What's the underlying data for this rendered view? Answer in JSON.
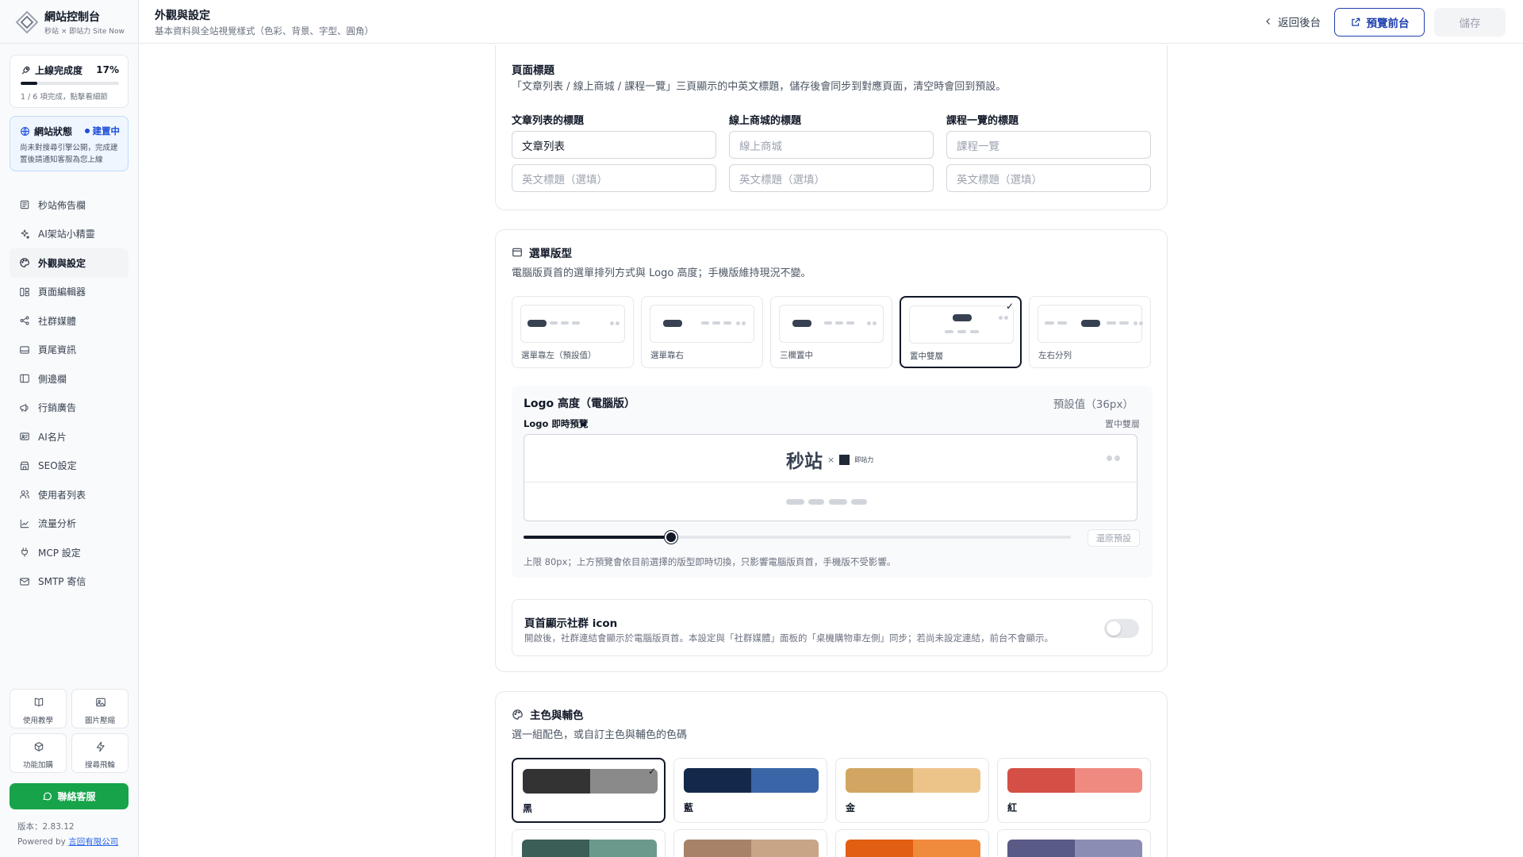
{
  "brand": {
    "title": "網站控制台",
    "subtitle": "秒站 × 即站力 Site Now"
  },
  "progress": {
    "label": "上線完成度",
    "percent_text": "17%",
    "fraction": 0.17,
    "detail": "1 / 6 項完成，點擊看細節"
  },
  "site_status": {
    "label": "網站狀態",
    "badge": "建置中",
    "description": "尚未對搜尋引擎公開，完成建置後請通知客服為您上線"
  },
  "nav": [
    {
      "label": "秒站佈告欄",
      "icon": "newspaper-icon"
    },
    {
      "label": "AI架站小精靈",
      "icon": "sparkles-icon"
    },
    {
      "label": "外觀與設定",
      "icon": "palette-icon",
      "active": true
    },
    {
      "label": "頁面編輯器",
      "icon": "layout-icon"
    },
    {
      "label": "社群媒體",
      "icon": "share-icon"
    },
    {
      "label": "頁尾資訊",
      "icon": "footer-icon"
    },
    {
      "label": "側邊欄",
      "icon": "sidebar-icon"
    },
    {
      "label": "行銷廣告",
      "icon": "megaphone-icon"
    },
    {
      "label": "AI名片",
      "icon": "id-card-icon"
    },
    {
      "label": "SEO設定",
      "icon": "store-icon"
    },
    {
      "label": "使用者列表",
      "icon": "users-icon"
    },
    {
      "label": "流量分析",
      "icon": "chart-icon"
    },
    {
      "label": "MCP 設定",
      "icon": "plug-icon"
    },
    {
      "label": "SMTP 寄信",
      "icon": "mail-icon"
    }
  ],
  "tools": [
    {
      "label": "使用教學",
      "icon": "book-icon"
    },
    {
      "label": "圖片壓縮",
      "icon": "image-icon"
    },
    {
      "label": "功能加購",
      "icon": "package-icon"
    },
    {
      "label": "搜尋飛輪",
      "icon": "zap-icon"
    }
  ],
  "contact_label": "聯絡客服",
  "version": "版本：2.83.12",
  "powered_prefix": "Powered by ",
  "powered_link": "言回有限公司",
  "header": {
    "title": "外觀與設定",
    "subtitle": "基本資料與全站視覺樣式（色彩、背景、字型、圓角）",
    "back_label": "返回後台",
    "preview_label": "預覽前台",
    "save_label": "儲存"
  },
  "page_titles": {
    "title": "頁面標題",
    "description": "「文章列表 / 線上商城 / 課程一覽」三頁顯示的中英文標題，儲存後會同步到對應頁面，清空時會回到預設。",
    "fields": [
      {
        "label": "文章列表的標題",
        "value": "文章列表",
        "placeholder": "文章列表",
        "en_placeholder": "英文標題（選填）",
        "filled": true
      },
      {
        "label": "線上商城的標題",
        "value": "",
        "placeholder": "線上商城",
        "en_placeholder": "英文標題（選填）",
        "filled": false
      },
      {
        "label": "課程一覽的標題",
        "value": "",
        "placeholder": "課程一覽",
        "en_placeholder": "英文標題（選填）",
        "filled": false
      }
    ]
  },
  "menu_layout": {
    "title": "選單版型",
    "description": "電腦版頁首的選單排列方式與 Logo 高度；手機版維持現況不變。",
    "options": [
      {
        "label": "選單靠左（預設值）",
        "selected": false
      },
      {
        "label": "選單靠右",
        "selected": false
      },
      {
        "label": "三欄置中",
        "selected": false
      },
      {
        "label": "置中雙層",
        "selected": true
      },
      {
        "label": "左右分列",
        "selected": false
      }
    ],
    "logo_height": {
      "title": "Logo 高度（電腦版）",
      "value_text": "預設值（36px）",
      "preview_label": "Logo 即時預覽",
      "preview_mode": "置中雙層",
      "slider_fraction": 0.27,
      "reset_label": "還原預設",
      "note": "上限 80px；上方預覽會依目前選擇的版型即時切換，只影響電腦版頁首，手機版不受影響。",
      "logo_text": "秒站",
      "logo_x": "×",
      "logo_partner": "即站力"
    },
    "social": {
      "title": "頁首顯示社群 icon",
      "description": "開啟後，社群連結會顯示於電腦版頁首。本設定與「社群媒體」面板的「桌機購物車左側」同步；若尚未設定連結，前台不會顯示。",
      "enabled": false
    }
  },
  "colors": {
    "title": "主色與輔色",
    "description": "選一組配色，或自訂主色與輔色的色碼",
    "swatches": [
      {
        "name": "黑",
        "primary": "#333333",
        "secondary": "#8a8a8a",
        "selected": true
      },
      {
        "name": "藍",
        "primary": "#13294b",
        "secondary": "#3a66a8",
        "selected": false
      },
      {
        "name": "金",
        "primary": "#d2a662",
        "secondary": "#ecc48a",
        "selected": false
      },
      {
        "name": "紅",
        "primary": "#d44f45",
        "secondary": "#ee8a80",
        "selected": false
      },
      {
        "name": "",
        "primary": "#3b5f56",
        "secondary": "#6b9a8c",
        "selected": false
      },
      {
        "name": "",
        "primary": "#a78268",
        "secondary": "#c8a587",
        "selected": false
      },
      {
        "name": "",
        "primary": "#e15e12",
        "secondary": "#f08a3c",
        "selected": false
      },
      {
        "name": "",
        "primary": "#595a86",
        "secondary": "#8c8db5",
        "selected": false
      }
    ]
  },
  "theme": {
    "accent": "#111827",
    "link": "#1e40af",
    "success": "#16a34a"
  }
}
